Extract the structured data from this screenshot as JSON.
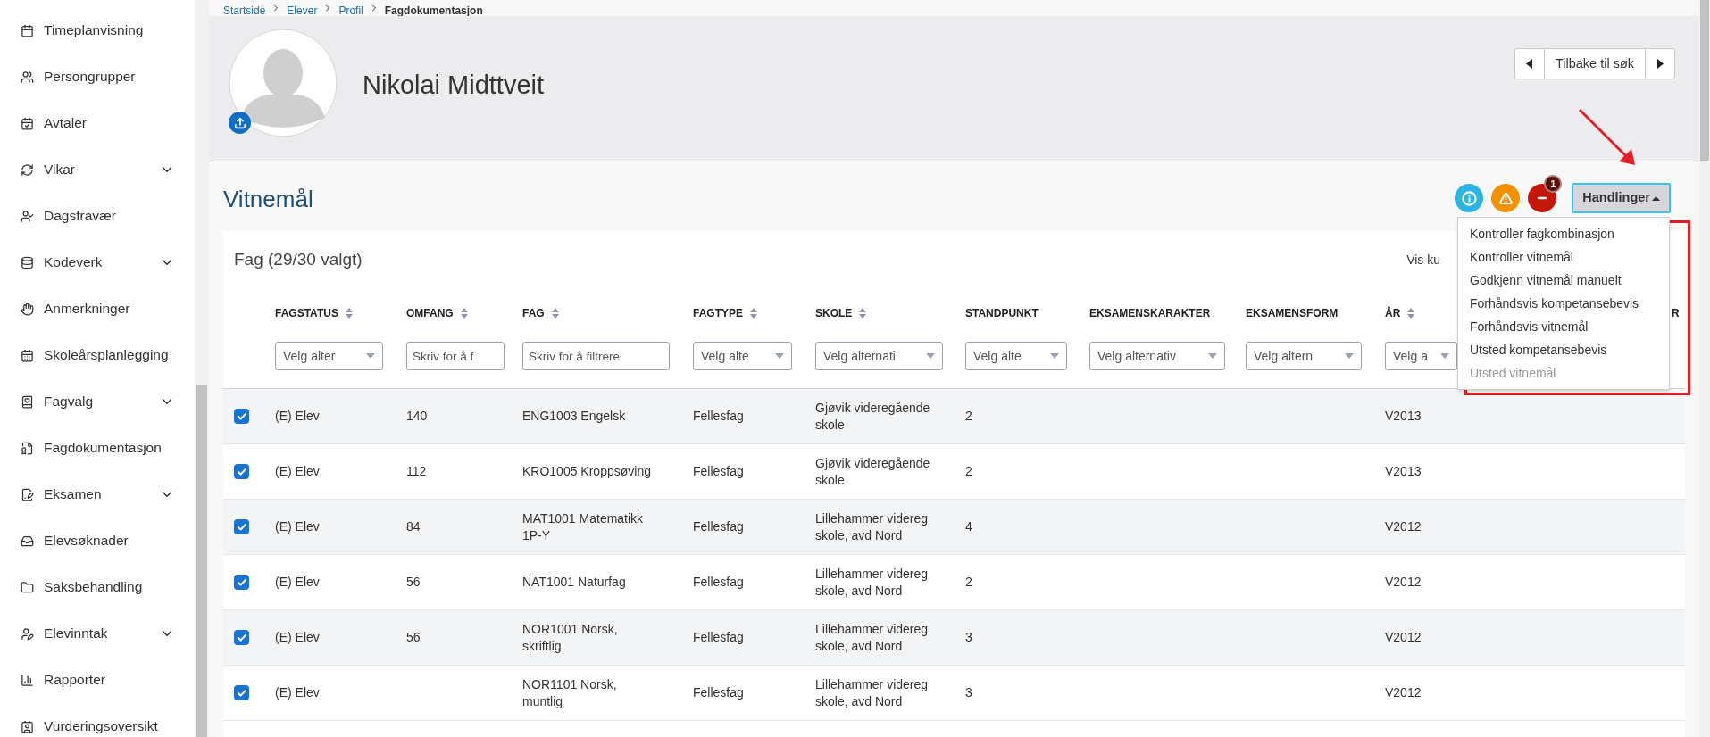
{
  "sidebar": {
    "items": [
      {
        "label": "Timeplanvisning",
        "expandable": false
      },
      {
        "label": "Persongrupper",
        "expandable": false
      },
      {
        "label": "Avtaler",
        "expandable": false
      },
      {
        "label": "Vikar",
        "expandable": true
      },
      {
        "label": "Dagsfravær",
        "expandable": false
      },
      {
        "label": "Kodeverk",
        "expandable": true
      },
      {
        "label": "Anmerkninger",
        "expandable": false
      },
      {
        "label": "Skoleårsplanlegging",
        "expandable": false
      },
      {
        "label": "Fagvalg",
        "expandable": true
      },
      {
        "label": "Fagdokumentasjon",
        "expandable": false
      },
      {
        "label": "Eksamen",
        "expandable": true
      },
      {
        "label": "Elevsøknader",
        "expandable": false
      },
      {
        "label": "Saksbehandling",
        "expandable": false
      },
      {
        "label": "Elevinntak",
        "expandable": true
      },
      {
        "label": "Rapporter",
        "expandable": false
      },
      {
        "label": "Vurderingsoversikt",
        "expandable": false
      }
    ]
  },
  "breadcrumb": [
    {
      "label": "Startside",
      "current": false
    },
    {
      "label": "Elever",
      "current": false
    },
    {
      "label": "Profil",
      "current": false
    },
    {
      "label": "Fagdokumentasjon",
      "current": true
    }
  ],
  "profile": {
    "name": "Nikolai Midttveit",
    "back_button": "Tilbake til søk"
  },
  "section": {
    "title": "Vitnemål",
    "status_icons": [
      {
        "kind": "info",
        "color": "#2bb5e0"
      },
      {
        "kind": "warning",
        "color": "#f39200"
      },
      {
        "kind": "error",
        "color": "#c4170c",
        "badge": "1"
      }
    ],
    "actions_button": "Handlinger",
    "actions_menu": [
      {
        "label": "Kontroller fagkombinasjon",
        "disabled": false
      },
      {
        "label": "Kontroller vitnemål",
        "disabled": false
      },
      {
        "label": "Godkjenn vitnemål manuelt",
        "disabled": false
      },
      {
        "label": "Forhåndsvis kompetansebevis",
        "disabled": false
      },
      {
        "label": "Forhåndsvis vitnemål",
        "disabled": false
      },
      {
        "label": "Utsted kompetansebevis",
        "disabled": false
      },
      {
        "label": "Utsted vitnemål",
        "disabled": true
      }
    ]
  },
  "table": {
    "title": "Fag (29/30 valgt)",
    "link": "Vis ku",
    "columns": [
      {
        "label": "FAGSTATUS",
        "sortable": true,
        "filter": {
          "kind": "select",
          "placeholder": "Velg alter"
        }
      },
      {
        "label": "OMFANG",
        "sortable": true,
        "filter": {
          "kind": "text",
          "placeholder": "Skriv for å f"
        }
      },
      {
        "label": "FAG",
        "sortable": true,
        "filter": {
          "kind": "text",
          "placeholder": "Skriv for å filtrere"
        }
      },
      {
        "label": "FAGTYPE",
        "sortable": true,
        "filter": {
          "kind": "select",
          "placeholder": "Velg alte"
        }
      },
      {
        "label": "SKOLE",
        "sortable": true,
        "filter": {
          "kind": "select",
          "placeholder": "Velg alternati"
        }
      },
      {
        "label": "STANDPUNKT",
        "sortable": false,
        "filter": {
          "kind": "select",
          "placeholder": "Velg alte"
        }
      },
      {
        "label": "EKSAMENSKARAKTER",
        "sortable": false,
        "filter": {
          "kind": "select",
          "placeholder": "Velg alternativ"
        }
      },
      {
        "label": "EKSAMENSFORM",
        "sortable": false,
        "filter": {
          "kind": "select",
          "placeholder": "Velg altern"
        }
      },
      {
        "label": "ÅR",
        "sortable": true,
        "filter": {
          "kind": "select",
          "placeholder": "Velg a"
        }
      },
      {
        "label": "R",
        "sortable": false
      }
    ],
    "rows": [
      {
        "checked": true,
        "cells": [
          "(E) Elev",
          "140",
          "ENG1003 Engelsk",
          "Fellesfag",
          "Gjøvik videregående skole",
          "2",
          "",
          "",
          "V2013",
          ""
        ]
      },
      {
        "checked": true,
        "cells": [
          "(E) Elev",
          "112",
          "KRO1005 Kroppsøving",
          "Fellesfag",
          "Gjøvik videregående skole",
          "2",
          "",
          "",
          "V2013",
          ""
        ]
      },
      {
        "checked": true,
        "cells": [
          "(E) Elev",
          "84",
          "MAT1001 Matematikk 1P-Y",
          "Fellesfag",
          "Lillehammer videreg skole, avd Nord",
          "4",
          "",
          "",
          "V2012",
          ""
        ]
      },
      {
        "checked": true,
        "cells": [
          "(E) Elev",
          "56",
          "NAT1001 Naturfag",
          "Fellesfag",
          "Lillehammer videreg skole, avd Nord",
          "2",
          "",
          "",
          "V2012",
          ""
        ]
      },
      {
        "checked": true,
        "cells": [
          "(E) Elev",
          "56",
          "NOR1001 Norsk, skriftlig",
          "Fellesfag",
          "Lillehammer videreg skole, avd Nord",
          "3",
          "",
          "",
          "V2012",
          ""
        ]
      },
      {
        "checked": true,
        "cells": [
          "(E) Elev",
          "",
          "NOR1101 Norsk, muntlig",
          "Fellesfag",
          "Lillehammer videreg skole, avd Nord",
          "3",
          "",
          "",
          "V2012",
          ""
        ]
      }
    ]
  }
}
